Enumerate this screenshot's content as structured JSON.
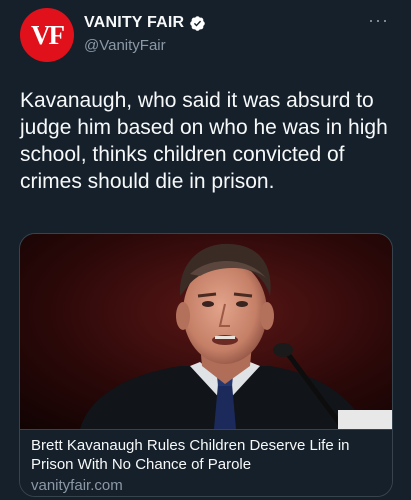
{
  "account": {
    "avatar_text": "VF",
    "display_name": "VANITY FAIR",
    "handle": "@VanityFair",
    "verified": true
  },
  "menu": {
    "more_label": "···"
  },
  "tweet": {
    "text": "Kavanaugh, who said it was absurd to judge him based on who he was in high school, thinks children convicted of crimes should die in prison."
  },
  "link_card": {
    "title": "Brett Kavanaugh Rules Children Deserve Life in Prison With No Chance of Parole",
    "domain": "vanityfair.com"
  },
  "colors": {
    "background": "#15202b",
    "avatar_red": "#e0111b",
    "secondary_text": "#8b98a5",
    "border": "#38444d"
  },
  "icons": [
    "vf-logo",
    "verified-badge-icon",
    "more-options-icon",
    "microphone"
  ]
}
